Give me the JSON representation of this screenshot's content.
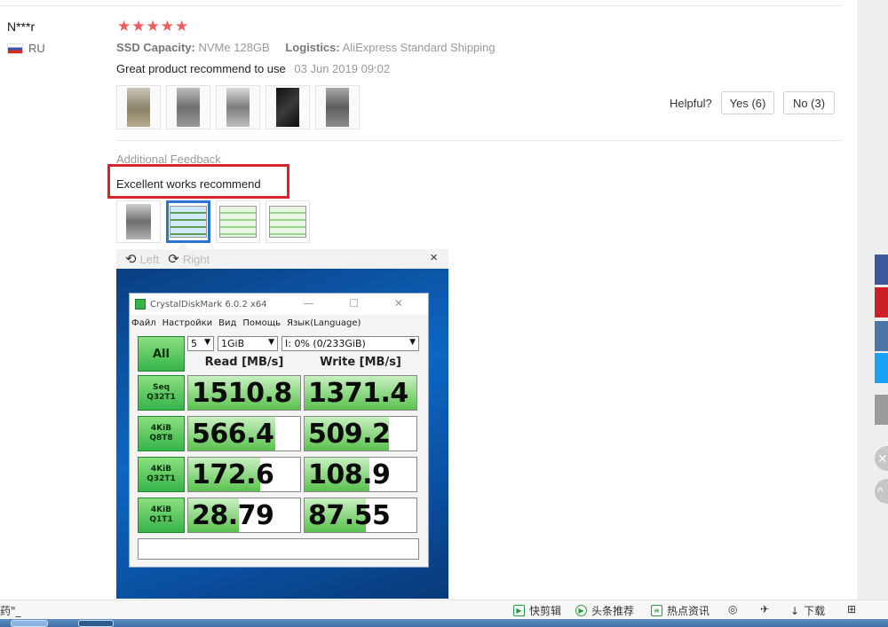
{
  "reviewer": {
    "name": "N***r",
    "country": "RU"
  },
  "review": {
    "stars": "★★★★★",
    "capacity_label": "SSD Capacity:",
    "capacity_value": "NVMe 128GB",
    "logistics_label": "Logistics:",
    "logistics_value": "AliExpress Standard Shipping",
    "text": "Great product recommend to use",
    "date": "03 Jun 2019 09:02"
  },
  "helpful": {
    "label": "Helpful?",
    "yes": "Yes (6)",
    "no": "No (3)"
  },
  "additional": {
    "label": "Additional Feedback",
    "text": "Excellent works recommend"
  },
  "viewer": {
    "rotate_left_icon": "⟲",
    "left": "Left",
    "rotate_right_icon": "⟳",
    "right": "Right",
    "close": "×"
  },
  "cdm": {
    "title": "CrystalDiskMark 6.0.2 x64",
    "window_buttons": "— ☐ ✕",
    "menu": [
      "Файл",
      "Настройки",
      "Вид",
      "Помощь",
      "Язык(Language)"
    ],
    "all": "All",
    "count": "5",
    "size": "1GiB",
    "drive": "I: 0% (0/233GiB)",
    "read_header": "Read [MB/s]",
    "write_header": "Write [MB/s]",
    "rows": [
      {
        "label1": "Seq",
        "label2": "Q32T1",
        "read": "1510.8",
        "write": "1371.4",
        "read_fill": 1.0,
        "write_fill": 1.0
      },
      {
        "label1": "4KiB",
        "label2": "Q8T8",
        "read": "566.4",
        "write": "509.2",
        "read_fill": 0.78,
        "write_fill": 0.75
      },
      {
        "label1": "4KiB",
        "label2": "Q32T1",
        "read": "172.6",
        "write": "108.9",
        "read_fill": 0.64,
        "write_fill": 0.58
      },
      {
        "label1": "4KiB",
        "label2": "Q1T1",
        "read": "28.79",
        "write": "87.55",
        "read_fill": 0.45,
        "write_fill": 0.55
      }
    ]
  },
  "statusbar": {
    "left": "药\"_",
    "items": [
      "快剪辑",
      "头条推荐",
      "热点资讯",
      "下载"
    ],
    "icons": [
      "play-icon",
      "play-circle-icon",
      "news-icon",
      "browser-icon",
      "pin-icon",
      "download-icon",
      "grid-icon"
    ]
  },
  "colors": {
    "stars": "#ef5a5a",
    "highlight_box": "#d6262c",
    "cdm_green": "#37b34a",
    "selected_thumb": "#2c74d1"
  }
}
